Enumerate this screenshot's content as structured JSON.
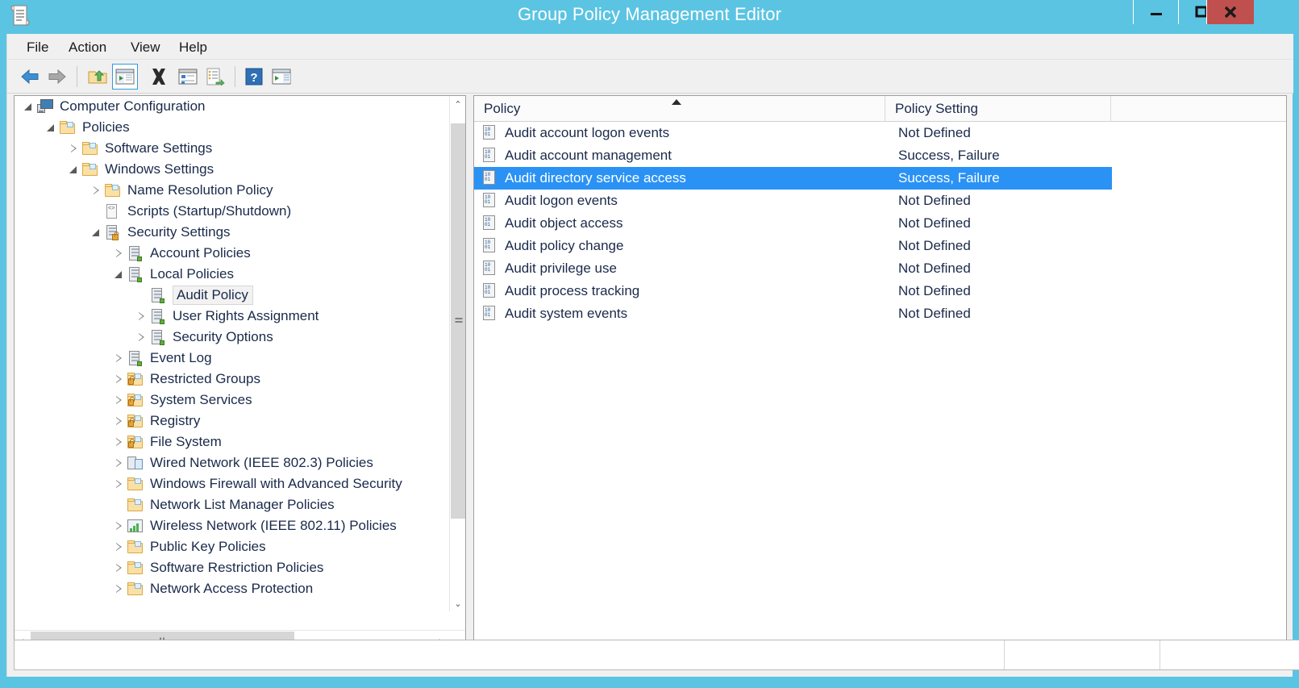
{
  "window": {
    "title": "Group Policy Management Editor",
    "app_icon": "document-scroll-icon",
    "controls": {
      "minimize": "–",
      "maximize": "□",
      "close": "X",
      "close_color": "#C0504D",
      "titlebar_color": "#5BC4E2"
    }
  },
  "menubar": {
    "items": [
      {
        "label": "File"
      },
      {
        "label": "Action"
      },
      {
        "label": "View"
      },
      {
        "label": "Help"
      }
    ]
  },
  "toolbar": {
    "buttons": [
      {
        "name": "back-button",
        "icon": "back-arrow-icon"
      },
      {
        "name": "forward-button",
        "icon": "forward-arrow-icon"
      },
      {
        "name": "up-one-level-button",
        "icon": "folder-up-icon"
      },
      {
        "name": "show-hide-console-tree-button",
        "icon": "console-tree-icon",
        "active": true
      },
      {
        "name": "delete-button",
        "icon": "delete-x-icon"
      },
      {
        "name": "properties-button",
        "icon": "properties-window-icon"
      },
      {
        "name": "export-list-button",
        "icon": "export-list-icon"
      },
      {
        "name": "help-button",
        "icon": "help-question-icon"
      },
      {
        "name": "show-hide-action-pane-button",
        "icon": "action-pane-icon"
      }
    ]
  },
  "tree": {
    "nodes": [
      {
        "label": "Computer Configuration",
        "indent": 0,
        "state": "open",
        "icon": "computer-icon"
      },
      {
        "label": "Policies",
        "indent": 1,
        "state": "open",
        "icon": "folder-icon"
      },
      {
        "label": "Software Settings",
        "indent": 2,
        "state": "closed",
        "icon": "folder-icon"
      },
      {
        "label": "Windows Settings",
        "indent": 2,
        "state": "open",
        "icon": "folder-icon"
      },
      {
        "label": "Name Resolution Policy",
        "indent": 3,
        "state": "closed",
        "icon": "folder-icon"
      },
      {
        "label": "Scripts (Startup/Shutdown)",
        "indent": 3,
        "state": "leaf",
        "icon": "script-icon"
      },
      {
        "label": "Security Settings",
        "indent": 3,
        "state": "open",
        "icon": "server-lock-icon"
      },
      {
        "label": "Account Policies",
        "indent": 4,
        "state": "closed",
        "icon": "server-icon"
      },
      {
        "label": "Local Policies",
        "indent": 4,
        "state": "open",
        "icon": "server-icon"
      },
      {
        "label": "Audit Policy",
        "indent": 5,
        "state": "leaf",
        "icon": "server-icon",
        "selected": true
      },
      {
        "label": "User Rights Assignment",
        "indent": 5,
        "state": "closed",
        "icon": "server-icon"
      },
      {
        "label": "Security Options",
        "indent": 5,
        "state": "closed",
        "icon": "server-icon"
      },
      {
        "label": "Event Log",
        "indent": 4,
        "state": "closed",
        "icon": "server-icon"
      },
      {
        "label": "Restricted Groups",
        "indent": 4,
        "state": "closed",
        "icon": "folder-lock-icon"
      },
      {
        "label": "System Services",
        "indent": 4,
        "state": "closed",
        "icon": "folder-lock-icon"
      },
      {
        "label": "Registry",
        "indent": 4,
        "state": "closed",
        "icon": "folder-lock-icon"
      },
      {
        "label": "File System",
        "indent": 4,
        "state": "closed",
        "icon": "folder-lock-icon"
      },
      {
        "label": "Wired Network (IEEE 802.3) Policies",
        "indent": 4,
        "state": "closed",
        "icon": "network-icon"
      },
      {
        "label": "Windows Firewall with Advanced Security",
        "indent": 4,
        "state": "closed",
        "icon": "folder-icon"
      },
      {
        "label": "Network List Manager Policies",
        "indent": 4,
        "state": "leaf",
        "icon": "folder-icon"
      },
      {
        "label": "Wireless Network (IEEE 802.11) Policies",
        "indent": 4,
        "state": "closed",
        "icon": "wifi-icon"
      },
      {
        "label": "Public Key Policies",
        "indent": 4,
        "state": "closed",
        "icon": "folder-icon"
      },
      {
        "label": "Software Restriction Policies",
        "indent": 4,
        "state": "closed",
        "icon": "folder-icon"
      },
      {
        "label": "Network Access Protection",
        "indent": 4,
        "state": "closed",
        "icon": "folder-icon"
      }
    ],
    "scrollbars": {
      "vertical_up_arrow": "⌃",
      "vertical_down_arrow": "⌄",
      "horizontal_left_arrow": "‹",
      "horizontal_right_arrow": "›"
    }
  },
  "list": {
    "columns": [
      {
        "label": "Policy",
        "sorted": "asc"
      },
      {
        "label": "Policy Setting"
      },
      {
        "label": ""
      }
    ],
    "rows": [
      {
        "policy": "Audit account logon events",
        "setting": "Not Defined",
        "selected": false
      },
      {
        "policy": "Audit account management",
        "setting": "Success, Failure",
        "selected": false
      },
      {
        "policy": "Audit directory service access",
        "setting": "Success, Failure",
        "selected": true
      },
      {
        "policy": "Audit logon events",
        "setting": "Not Defined",
        "selected": false
      },
      {
        "policy": "Audit object access",
        "setting": "Not Defined",
        "selected": false
      },
      {
        "policy": "Audit policy change",
        "setting": "Not Defined",
        "selected": false
      },
      {
        "policy": "Audit privilege use",
        "setting": "Not Defined",
        "selected": false
      },
      {
        "policy": "Audit process tracking",
        "setting": "Not Defined",
        "selected": false
      },
      {
        "policy": "Audit system events",
        "setting": "Not Defined",
        "selected": false
      }
    ],
    "selection_color": "#2a92f5"
  },
  "statusbar": {
    "main": "",
    "middle": "",
    "right": ""
  }
}
